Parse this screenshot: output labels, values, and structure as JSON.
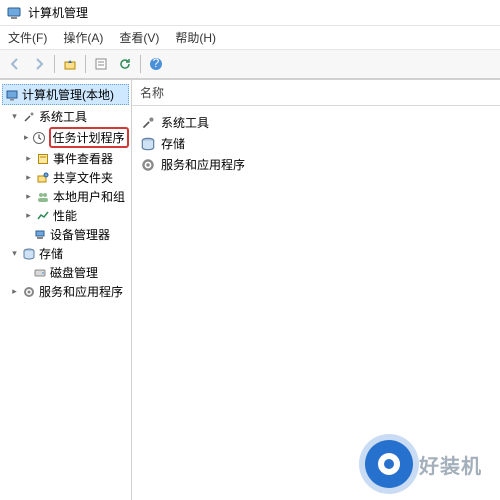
{
  "title": "计算机管理",
  "menu": {
    "file": "文件(F)",
    "action": "操作(A)",
    "view": "查看(V)",
    "help": "帮助(H)"
  },
  "toolbar": {
    "back": "back",
    "forward": "forward",
    "up": "up",
    "props": "properties",
    "refresh": "refresh",
    "help": "help"
  },
  "tree": {
    "root": "计算机管理(本地)",
    "system_tools": "系统工具",
    "task_scheduler": "任务计划程序",
    "event_viewer": "事件查看器",
    "shared_folders": "共享文件夹",
    "local_users": "本地用户和组",
    "performance": "性能",
    "device_mgr": "设备管理器",
    "storage": "存储",
    "disk_mgmt": "磁盘管理",
    "services_apps": "服务和应用程序"
  },
  "list": {
    "header_name": "名称",
    "items": [
      {
        "label": "系统工具"
      },
      {
        "label": "存储"
      },
      {
        "label": "服务和应用程序"
      }
    ]
  },
  "watermark": {
    "text": "好装机"
  }
}
